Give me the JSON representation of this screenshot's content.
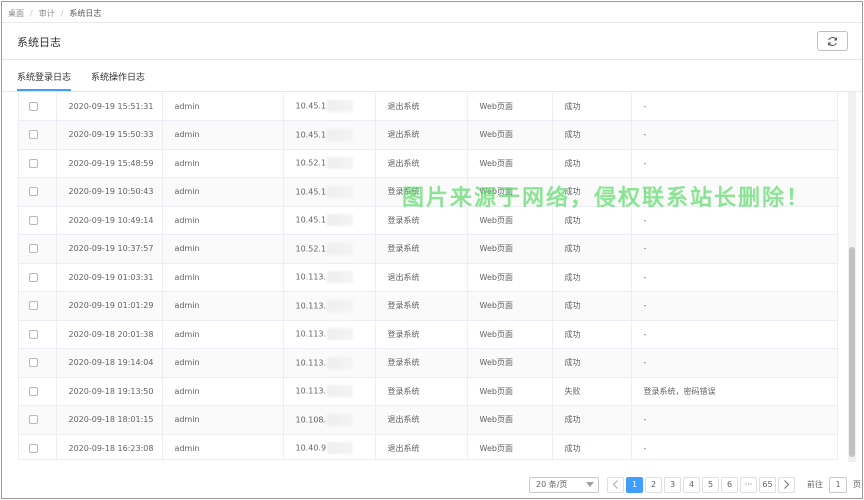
{
  "breadcrumb": [
    "桌面",
    "审计",
    "系统日志"
  ],
  "page_title": "系统日志",
  "tabs": [
    {
      "label": "系统登录日志",
      "active": true
    },
    {
      "label": "系统操作日志",
      "active": false
    }
  ],
  "rows": [
    {
      "time": "2020-09-19 15:51:31",
      "user": "admin",
      "ip": "10.45.1",
      "action": "退出系统",
      "client": "Web页面",
      "status": "成功",
      "remark": "-"
    },
    {
      "time": "2020-09-19 15:50:33",
      "user": "admin",
      "ip": "10.45.1",
      "action": "退出系统",
      "client": "Web页面",
      "status": "成功",
      "remark": "-"
    },
    {
      "time": "2020-09-19 15:48:59",
      "user": "admin",
      "ip": "10.52.1",
      "action": "退出系统",
      "client": "Web页面",
      "status": "成功",
      "remark": "-"
    },
    {
      "time": "2020-09-19 10:50:43",
      "user": "admin",
      "ip": "10.45.1",
      "action": "登录系统",
      "client": "Web页面",
      "status": "成功",
      "remark": "-"
    },
    {
      "time": "2020-09-19 10:49:14",
      "user": "admin",
      "ip": "10.45.1",
      "action": "登录系统",
      "client": "Web页面",
      "status": "成功",
      "remark": "-"
    },
    {
      "time": "2020-09-19 10:37:57",
      "user": "admin",
      "ip": "10.52.1",
      "action": "登录系统",
      "client": "Web页面",
      "status": "成功",
      "remark": "-"
    },
    {
      "time": "2020-09-19 01:03:31",
      "user": "admin",
      "ip": "10.113.",
      "action": "退出系统",
      "client": "Web页面",
      "status": "成功",
      "remark": "-"
    },
    {
      "time": "2020-09-19 01:01:29",
      "user": "admin",
      "ip": "10.113.",
      "action": "登录系统",
      "client": "Web页面",
      "status": "成功",
      "remark": "-"
    },
    {
      "time": "2020-09-18 20:01:38",
      "user": "admin",
      "ip": "10.113.",
      "action": "登录系统",
      "client": "Web页面",
      "status": "成功",
      "remark": "-"
    },
    {
      "time": "2020-09-18 19:14:04",
      "user": "admin",
      "ip": "10.113.",
      "action": "登录系统",
      "client": "Web页面",
      "status": "成功",
      "remark": "-"
    },
    {
      "time": "2020-09-18 19:13:50",
      "user": "admin",
      "ip": "10.113.",
      "action": "登录系统",
      "client": "Web页面",
      "status": "失败",
      "remark": "登录系统，密码错误"
    },
    {
      "time": "2020-09-18 18:01:15",
      "user": "admin",
      "ip": "10.108.",
      "action": "退出系统",
      "client": "Web页面",
      "status": "成功",
      "remark": "-"
    },
    {
      "time": "2020-09-18 16:23:08",
      "user": "admin",
      "ip": "10.40.9",
      "action": "退出系统",
      "client": "Web页面",
      "status": "成功",
      "remark": "-"
    }
  ],
  "pagination": {
    "page_size": "20 条/页",
    "pages": [
      "1",
      "2",
      "3",
      "4",
      "5",
      "6"
    ],
    "ellipsis": "···",
    "last": "65",
    "current": "1",
    "goto_prefix": "前往",
    "goto_value": "1",
    "goto_suffix": "页"
  },
  "watermark": "图片来源于网络，侵权联系站长删除！",
  "icons": {
    "refresh": "refresh-icon",
    "prev": "chevron-left-icon",
    "next": "chevron-right-icon"
  },
  "colors": {
    "accent": "#409eff",
    "watermark": "#5ddb6a"
  }
}
